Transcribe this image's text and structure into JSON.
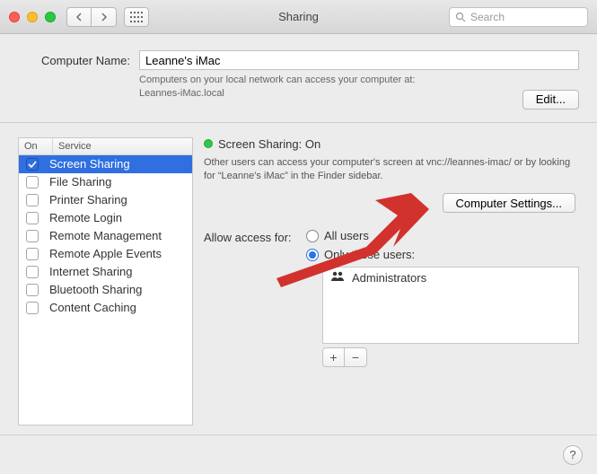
{
  "window": {
    "title": "Sharing",
    "search_placeholder": "Search"
  },
  "computer_name": {
    "label": "Computer Name:",
    "value": "Leanne's iMac",
    "hint_line1": "Computers on your local network can access your computer at:",
    "hint_line2": "Leannes-iMac.local",
    "edit_label": "Edit..."
  },
  "services": {
    "header_on": "On",
    "header_service": "Service",
    "items": [
      {
        "label": "Screen Sharing",
        "on": true,
        "selected": true
      },
      {
        "label": "File Sharing",
        "on": false,
        "selected": false
      },
      {
        "label": "Printer Sharing",
        "on": false,
        "selected": false
      },
      {
        "label": "Remote Login",
        "on": false,
        "selected": false
      },
      {
        "label": "Remote Management",
        "on": false,
        "selected": false
      },
      {
        "label": "Remote Apple Events",
        "on": false,
        "selected": false
      },
      {
        "label": "Internet Sharing",
        "on": false,
        "selected": false
      },
      {
        "label": "Bluetooth Sharing",
        "on": false,
        "selected": false
      },
      {
        "label": "Content Caching",
        "on": false,
        "selected": false
      }
    ]
  },
  "detail": {
    "status_title": "Screen Sharing: On",
    "status_desc": "Other users can access your computer's screen at vnc://leannes-imac/ or by looking for “Leanne's iMac” in the Finder sidebar.",
    "computer_settings_label": "Computer Settings...",
    "access_label": "Allow access for:",
    "radio_all_users": "All users",
    "radio_only_users": "Only these users:",
    "users": [
      {
        "label": "Administrators"
      }
    ]
  }
}
